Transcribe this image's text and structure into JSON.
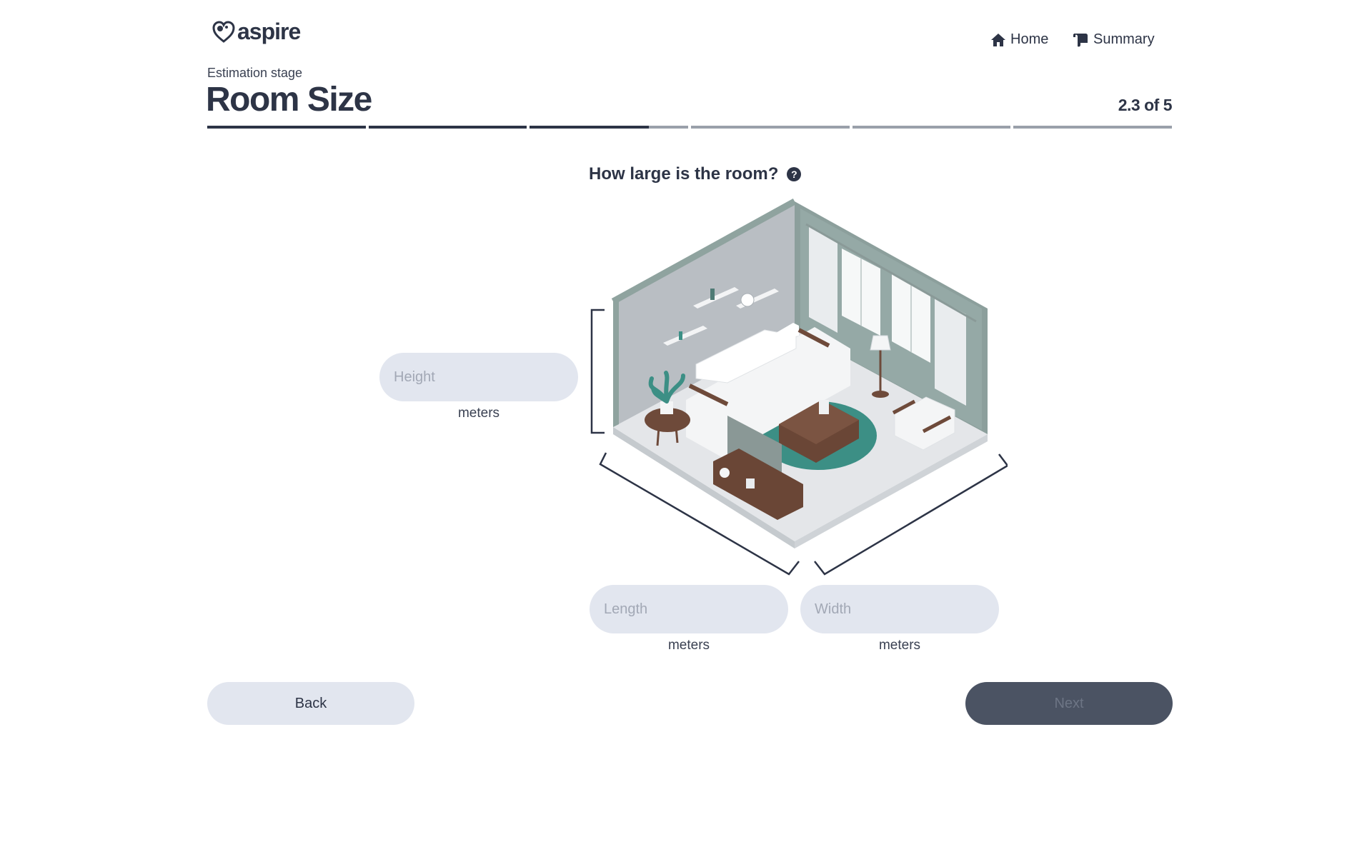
{
  "header": {
    "logo_text": "aspire",
    "nav": {
      "home_label": "Home",
      "summary_label": "Summary"
    }
  },
  "stage": {
    "label": "Estimation stage",
    "title": "Room Size",
    "step_counter": "2.3 of 5"
  },
  "progress": {
    "segments": [
      1,
      1,
      0.75,
      0,
      0,
      0
    ]
  },
  "question": {
    "text": "How large is the room?",
    "help_icon": "?"
  },
  "fields": {
    "height": {
      "placeholder": "Height",
      "unit": "meters",
      "value": ""
    },
    "length": {
      "placeholder": "Length",
      "unit": "meters",
      "value": ""
    },
    "width": {
      "placeholder": "Width",
      "unit": "meters",
      "value": ""
    }
  },
  "buttons": {
    "back_label": "Back",
    "next_label": "Next"
  },
  "colors": {
    "primary": "#2d3446",
    "input_bg": "#e2e6ef",
    "next_bg": "#4b5363",
    "progress_track": "#9aa0aa",
    "teal_accent": "#3c9086"
  },
  "icons": {
    "logo": "heart-globe-icon",
    "home": "home-icon",
    "summary": "scroll-icon",
    "help": "question-circle-icon",
    "room": "isometric-living-room-illustration"
  }
}
